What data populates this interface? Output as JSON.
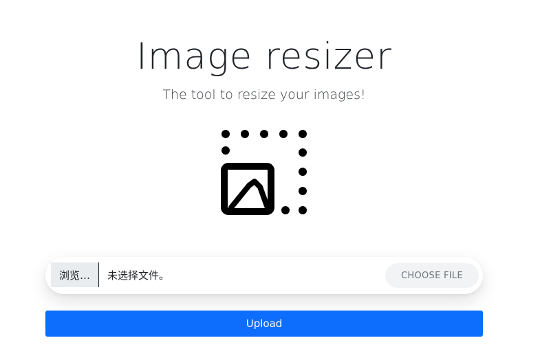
{
  "header": {
    "title": "Image resizer",
    "subtitle": "The tool to resize your images!"
  },
  "logo": {
    "icon": "resize-image-icon",
    "color": "#000000"
  },
  "file_input": {
    "browse_label": "浏览…",
    "status_text": "未选择文件。",
    "choose_label": "CHOOSE FILE"
  },
  "actions": {
    "upload_label": "Upload"
  },
  "colors": {
    "primary": "#0d6efd",
    "choose_bg": "#f1f3f5",
    "browse_bg": "#e9ecef"
  }
}
